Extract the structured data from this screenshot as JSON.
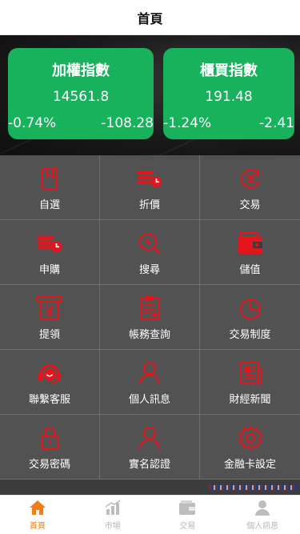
{
  "header": {
    "title": "首頁"
  },
  "cards": [
    {
      "title": "加權指數",
      "value": "14561.8",
      "pct": "-0.74%",
      "change": "-108.28"
    },
    {
      "title": "櫃買指數",
      "value": "191.48",
      "pct": "-1.24%",
      "change": "-2.41"
    }
  ],
  "grid": [
    {
      "label": "自選",
      "icon": "bookmark-icon"
    },
    {
      "label": "折價",
      "icon": "coins-clock-icon"
    },
    {
      "label": "交易",
      "icon": "yen-cycle-icon"
    },
    {
      "label": "申購",
      "icon": "coins-clock-icon"
    },
    {
      "label": "搜尋",
      "icon": "search-icon"
    },
    {
      "label": "儲值",
      "icon": "wallet-icon"
    },
    {
      "label": "提領",
      "icon": "atm-yen-icon"
    },
    {
      "label": "帳務查詢",
      "icon": "document-list-icon"
    },
    {
      "label": "交易制度",
      "icon": "pie-chart-icon"
    },
    {
      "label": "聯繫客服",
      "icon": "headset-icon"
    },
    {
      "label": "個人訊息",
      "icon": "user-icon"
    },
    {
      "label": "財經新聞",
      "icon": "newspaper-icon"
    },
    {
      "label": "交易密碼",
      "icon": "lock-icon"
    },
    {
      "label": "實名認證",
      "icon": "user-icon"
    },
    {
      "label": "金融卡設定",
      "icon": "gear-icon"
    }
  ],
  "tabs": [
    {
      "label": "首頁",
      "icon": "home-icon",
      "active": true
    },
    {
      "label": "市場",
      "icon": "bar-chart-icon",
      "active": false
    },
    {
      "label": "交易",
      "icon": "wallet-icon",
      "active": false
    },
    {
      "label": "個人訊息",
      "icon": "user-icon",
      "active": false
    }
  ],
  "colors": {
    "green": "#17b25b",
    "red": "#e4151d",
    "orange": "#ef7d1a",
    "grid_bg": "#535252"
  }
}
